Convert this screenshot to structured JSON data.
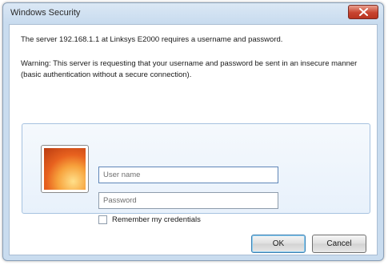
{
  "window": {
    "title": "Windows Security"
  },
  "message": {
    "primary": "The server 192.168.1.1 at Linksys E2000 requires a username and password.",
    "warning": "Warning: This server is requesting that your username and password be sent in an insecure manner (basic authentication without a secure connection)."
  },
  "credentials": {
    "username_placeholder": "User name",
    "username_value": "",
    "password_placeholder": "Password",
    "password_value": "",
    "remember_label": "Remember my credentials",
    "remember_checked": false
  },
  "buttons": {
    "ok_label": "OK",
    "cancel_label": "Cancel"
  },
  "colors": {
    "close_button": "#c8442f",
    "title_bar": "#c9dcef"
  }
}
